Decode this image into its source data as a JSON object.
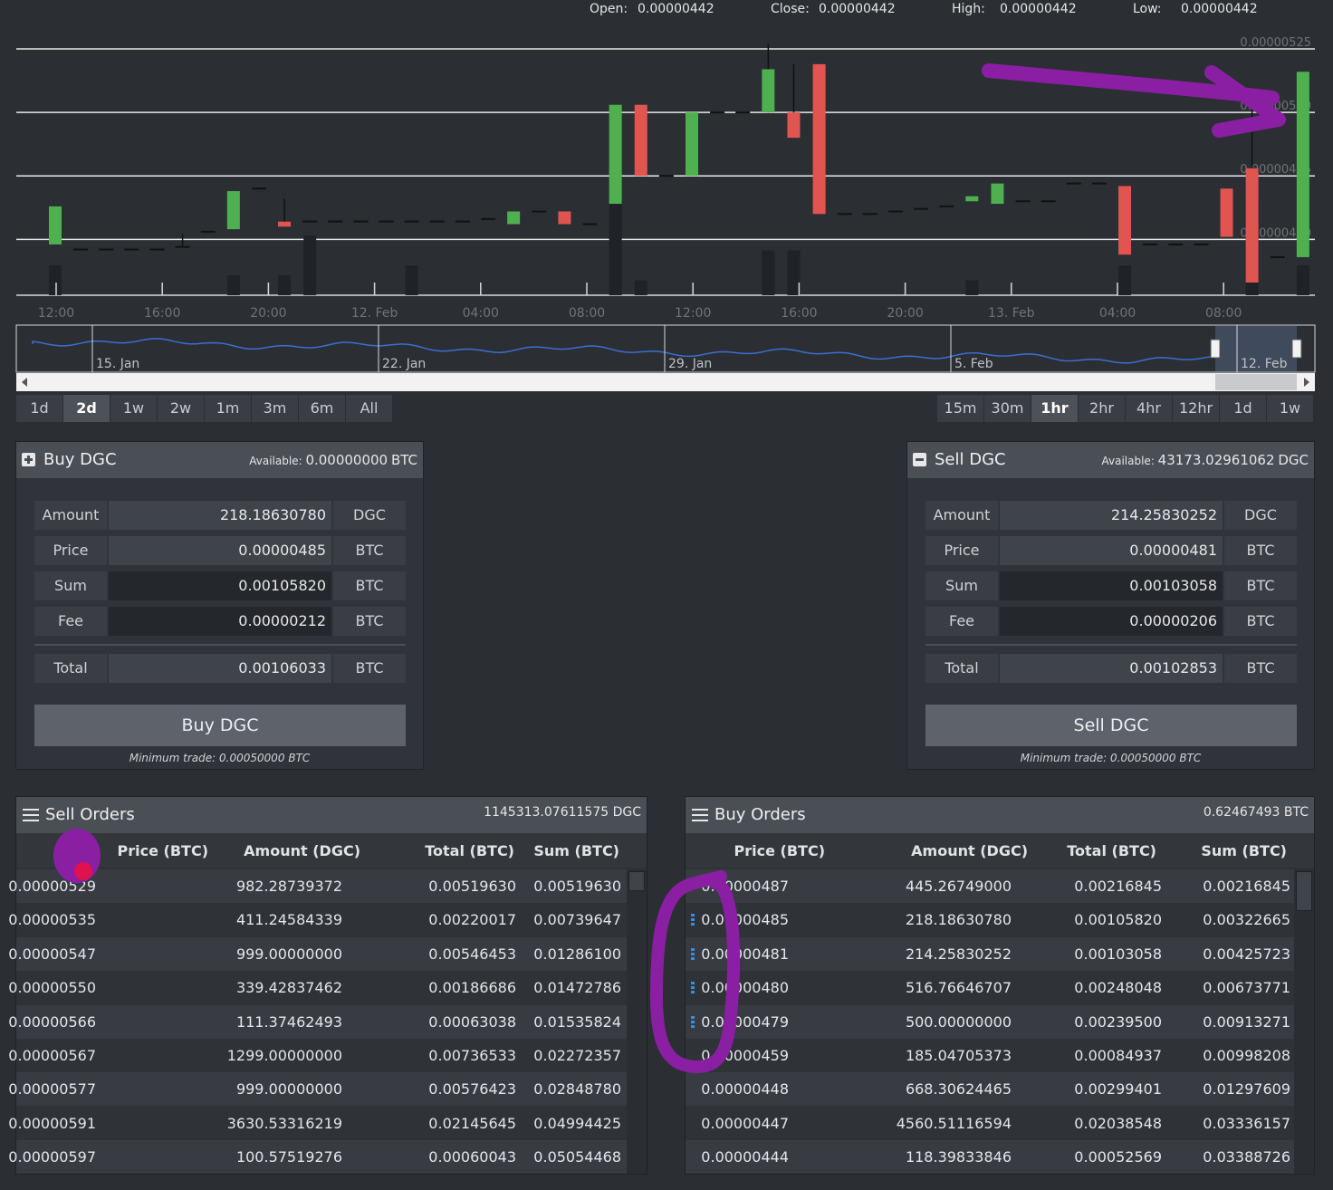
{
  "ohlc": {
    "open_label": "Open:",
    "open": "0.00000442",
    "close_label": "Close:",
    "close": "0.00000442",
    "high_label": "High:",
    "high": "0.00000442",
    "low_label": "Low:",
    "low": "0.00000442"
  },
  "chart_data": {
    "type": "candlestick",
    "y_ticks": [
      "0.00000525",
      "0.00000500",
      "0.00000475",
      "0.00000450"
    ],
    "ylim": [
      4.28e-06,
      5.3e-06
    ],
    "x_ticks": [
      "12:00",
      "16:00",
      "20:00",
      "12. Feb",
      "04:00",
      "08:00",
      "12:00",
      "16:00",
      "20:00",
      "13. Feb",
      "04:00",
      "08:00"
    ],
    "navigator_ticks": [
      "15. Jan",
      "22. Jan",
      "29. Jan",
      "5. Feb",
      "12. Feb"
    ],
    "candles": [
      {
        "o": 448,
        "c": 463,
        "h": 463,
        "l": 448,
        "v": 0.3
      },
      {
        "o": 446,
        "c": 446,
        "h": 446,
        "l": 446,
        "v": 0
      },
      {
        "o": 446,
        "c": 446,
        "h": 446,
        "l": 446,
        "v": 0
      },
      {
        "o": 446,
        "c": 446,
        "h": 446,
        "l": 446,
        "v": 0
      },
      {
        "o": 446,
        "c": 446,
        "h": 446,
        "l": 446,
        "v": 0
      },
      {
        "o": 447,
        "c": 447,
        "h": 452,
        "l": 447,
        "v": 0
      },
      {
        "o": 453,
        "c": 453,
        "h": 453,
        "l": 453,
        "v": 0
      },
      {
        "o": 454,
        "c": 469,
        "h": 469,
        "l": 454,
        "v": 0.2
      },
      {
        "o": 470,
        "c": 470,
        "h": 470,
        "l": 470,
        "v": 0
      },
      {
        "o": 457,
        "c": 455,
        "h": 466,
        "l": 455,
        "v": 0.2
      },
      {
        "o": 457,
        "c": 457,
        "h": 457,
        "l": 457,
        "v": 0.6
      },
      {
        "o": 457,
        "c": 457,
        "h": 457,
        "l": 457,
        "v": 0
      },
      {
        "o": 457,
        "c": 457,
        "h": 457,
        "l": 457,
        "v": 0
      },
      {
        "o": 457,
        "c": 457,
        "h": 457,
        "l": 457,
        "v": 0
      },
      {
        "o": 457,
        "c": 457,
        "h": 457,
        "l": 457,
        "v": 0.3
      },
      {
        "o": 457,
        "c": 457,
        "h": 457,
        "l": 457,
        "v": 0
      },
      {
        "o": 457,
        "c": 457,
        "h": 457,
        "l": 457,
        "v": 0
      },
      {
        "o": 458,
        "c": 458,
        "h": 458,
        "l": 458,
        "v": 0
      },
      {
        "o": 456,
        "c": 461,
        "h": 461,
        "l": 456,
        "v": 0
      },
      {
        "o": 461,
        "c": 461,
        "h": 461,
        "l": 461,
        "v": 0
      },
      {
        "o": 461,
        "c": 456,
        "h": 461,
        "l": 456,
        "v": 0
      },
      {
        "o": 456,
        "c": 456,
        "h": 456,
        "l": 456,
        "v": 0
      },
      {
        "o": 464,
        "c": 503,
        "h": 503,
        "l": 464,
        "v": 1.0
      },
      {
        "o": 503,
        "c": 475,
        "h": 503,
        "l": 475,
        "v": 0.15
      },
      {
        "o": 475,
        "c": 475,
        "h": 475,
        "l": 475,
        "v": 0
      },
      {
        "o": 475,
        "c": 500,
        "h": 500,
        "l": 475,
        "v": 0
      },
      {
        "o": 500,
        "c": 500,
        "h": 500,
        "l": 500,
        "v": 0
      },
      {
        "o": 500,
        "c": 500,
        "h": 500,
        "l": 500,
        "v": 0
      },
      {
        "o": 500,
        "c": 517,
        "h": 527,
        "l": 500,
        "v": 0.45
      },
      {
        "o": 500,
        "c": 490,
        "h": 519,
        "l": 490,
        "v": 0.45
      },
      {
        "o": 519,
        "c": 460,
        "h": 519,
        "l": 460,
        "v": 0
      },
      {
        "o": 460,
        "c": 460,
        "h": 460,
        "l": 460,
        "v": 0
      },
      {
        "o": 460,
        "c": 460,
        "h": 460,
        "l": 460,
        "v": 0
      },
      {
        "o": 461,
        "c": 461,
        "h": 461,
        "l": 461,
        "v": 0
      },
      {
        "o": 462,
        "c": 462,
        "h": 462,
        "l": 462,
        "v": 0
      },
      {
        "o": 463,
        "c": 463,
        "h": 463,
        "l": 463,
        "v": 0
      },
      {
        "o": 465,
        "c": 467,
        "h": 467,
        "l": 465,
        "v": 0.15
      },
      {
        "o": 464,
        "c": 472,
        "h": 472,
        "l": 464,
        "v": 0
      },
      {
        "o": 465,
        "c": 465,
        "h": 465,
        "l": 465,
        "v": 0
      },
      {
        "o": 465,
        "c": 465,
        "h": 465,
        "l": 465,
        "v": 0
      },
      {
        "o": 472,
        "c": 472,
        "h": 472,
        "l": 472,
        "v": 0
      },
      {
        "o": 472,
        "c": 472,
        "h": 472,
        "l": 472,
        "v": 0
      },
      {
        "o": 471,
        "c": 444,
        "h": 471,
        "l": 444,
        "v": 0.3
      },
      {
        "o": 448,
        "c": 448,
        "h": 448,
        "l": 448,
        "v": 0
      },
      {
        "o": 448,
        "c": 448,
        "h": 448,
        "l": 448,
        "v": 0
      },
      {
        "o": 448,
        "c": 448,
        "h": 448,
        "l": 448,
        "v": 0
      },
      {
        "o": 470,
        "c": 451,
        "h": 470,
        "l": 451,
        "v": 0
      },
      {
        "o": 478,
        "c": 433,
        "h": 505,
        "l": 433,
        "v": 0.95
      },
      {
        "o": 443,
        "c": 443,
        "h": 443,
        "l": 443,
        "v": 0
      },
      {
        "o": 443,
        "c": 516,
        "h": 516,
        "l": 443,
        "v": 0.3
      }
    ]
  },
  "range_buttons": [
    "1d",
    "2d",
    "1w",
    "2w",
    "1m",
    "3m",
    "6m",
    "All"
  ],
  "range_active": "2d",
  "interval_buttons": [
    "15m",
    "30m",
    "1hr",
    "2hr",
    "4hr",
    "12hr",
    "1d",
    "1w"
  ],
  "interval_active": "1hr",
  "buy": {
    "title": "Buy DGC",
    "available_label": "Available:",
    "available_value": "0.00000000",
    "available_unit": "BTC",
    "amount_label": "Amount",
    "amount": "218.18630780",
    "amount_unit": "DGC",
    "price_label": "Price",
    "price": "0.00000485",
    "price_unit": "BTC",
    "sum_label": "Sum",
    "sum": "0.00105820",
    "sum_unit": "BTC",
    "fee_label": "Fee",
    "fee": "0.00000212",
    "fee_unit": "BTC",
    "total_label": "Total",
    "total": "0.00106033",
    "total_unit": "BTC",
    "button": "Buy DGC",
    "min_trade": "Minimum trade: 0.00050000 BTC"
  },
  "sell": {
    "title": "Sell DGC",
    "available_label": "Available:",
    "available_value": "43173.02961062",
    "available_unit": "DGC",
    "amount_label": "Amount",
    "amount": "214.25830252",
    "amount_unit": "DGC",
    "price_label": "Price",
    "price": "0.00000481",
    "price_unit": "BTC",
    "sum_label": "Sum",
    "sum": "0.00103058",
    "sum_unit": "BTC",
    "fee_label": "Fee",
    "fee": "0.00000206",
    "fee_unit": "BTC",
    "total_label": "Total",
    "total": "0.00102853",
    "total_unit": "BTC",
    "button": "Sell DGC",
    "min_trade": "Minimum trade: 0.00050000 BTC"
  },
  "sell_orders": {
    "title": "Sell Orders",
    "total": "1145313.07611575 DGC",
    "columns": [
      "Price (BTC)",
      "Amount (DGC)",
      "Total (BTC)",
      "Sum (BTC)"
    ],
    "rows": [
      [
        "0.00000529",
        "982.28739372",
        "0.00519630",
        "0.00519630"
      ],
      [
        "0.00000535",
        "411.24584339",
        "0.00220017",
        "0.00739647"
      ],
      [
        "0.00000547",
        "999.00000000",
        "0.00546453",
        "0.01286100"
      ],
      [
        "0.00000550",
        "339.42837462",
        "0.00186686",
        "0.01472786"
      ],
      [
        "0.00000566",
        "111.37462493",
        "0.00063038",
        "0.01535824"
      ],
      [
        "0.00000567",
        "1299.00000000",
        "0.00736533",
        "0.02272357"
      ],
      [
        "0.00000577",
        "999.00000000",
        "0.00576423",
        "0.02848780"
      ],
      [
        "0.00000591",
        "3630.53316219",
        "0.02145645",
        "0.04994425"
      ],
      [
        "0.00000597",
        "100.57519276",
        "0.00060043",
        "0.05054468"
      ]
    ]
  },
  "buy_orders": {
    "title": "Buy Orders",
    "total": "0.62467493 BTC",
    "columns": [
      "Price (BTC)",
      "Amount (DGC)",
      "Total (BTC)",
      "Sum (BTC)"
    ],
    "rows": [
      [
        "0.00000487",
        "445.26749000",
        "0.00216845",
        "0.00216845"
      ],
      [
        "0.00000485",
        "218.18630780",
        "0.00105820",
        "0.00322665"
      ],
      [
        "0.00000481",
        "214.25830252",
        "0.00103058",
        "0.00425723"
      ],
      [
        "0.00000480",
        "516.76646707",
        "0.00248048",
        "0.00673771"
      ],
      [
        "0.00000479",
        "500.00000000",
        "0.00239500",
        "0.00913271"
      ],
      [
        "0.00000459",
        "185.04705373",
        "0.00084937",
        "0.00998208"
      ],
      [
        "0.00000448",
        "668.30624465",
        "0.00299401",
        "0.01297609"
      ],
      [
        "0.00000447",
        "4560.51116594",
        "0.02038548",
        "0.03336157"
      ],
      [
        "0.00000444",
        "118.39833846",
        "0.00052569",
        "0.03388726"
      ]
    ],
    "own_order_markers": [
      1,
      2,
      3,
      4
    ]
  },
  "colors": {
    "up": "#4fb04f",
    "down": "#e0554f",
    "accent": "#3b8fd6",
    "annotation": "#8b1fa3",
    "dot": "#e0114f"
  }
}
